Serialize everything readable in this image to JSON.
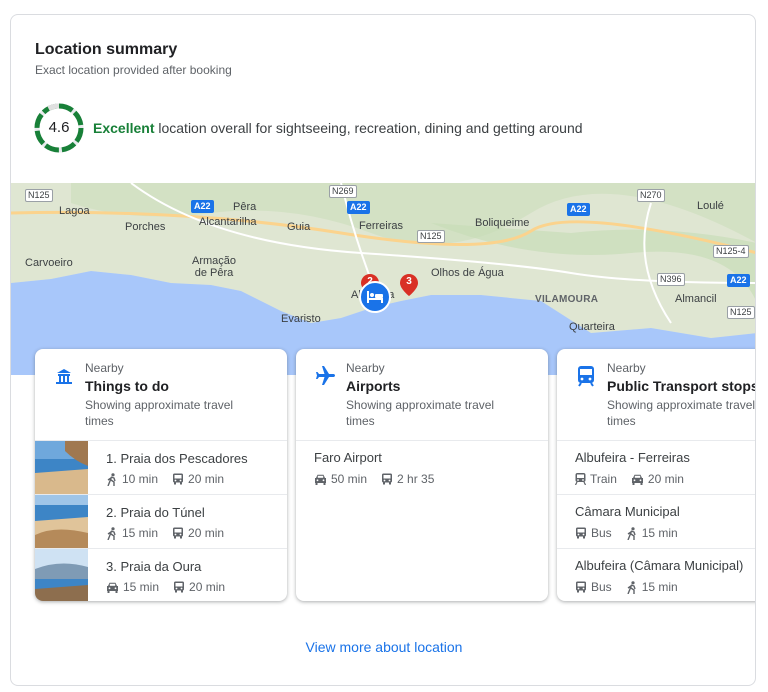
{
  "summary": {
    "title": "Location summary",
    "subtitle": "Exact location provided after booking",
    "score": "4.6",
    "score_fraction": 0.92,
    "rating_word": "Excellent",
    "rating_rest": " location overall for sightseeing, recreation, dining and getting around",
    "accent_color": "#188038"
  },
  "map": {
    "places": [
      "Lagoa",
      "Porches",
      "Pêra",
      "Alcantarilha",
      "Guia",
      "Ferreiras",
      "Boliqueime",
      "Loulé",
      "Carvoeiro",
      "Armação de Pêra",
      "Olhos de Água",
      "VILAMOURA",
      "Almancil",
      "Quarteira",
      "Evaristo",
      "Albufeira"
    ],
    "roads": [
      "N125",
      "N269",
      "A22",
      "A22",
      "A22",
      "N125",
      "N270",
      "N125-4",
      "N396",
      "A22",
      "N125"
    ],
    "pins": [
      "2",
      "3"
    ],
    "hotel_marker_icon": "bed-icon"
  },
  "cards": [
    {
      "kicker": "Nearby",
      "title": "Things to do",
      "desc": "Showing approximate travel times",
      "icon": "attraction-icon",
      "rows": [
        {
          "name": "1. Praia dos Pescadores",
          "t1_icon": "walk-icon",
          "t1": "10 min",
          "t2_icon": "bus-icon",
          "t2": "20 min"
        },
        {
          "name": "2. Praia do Túnel",
          "t1_icon": "walk-icon",
          "t1": "15 min",
          "t2_icon": "bus-icon",
          "t2": "20 min"
        },
        {
          "name": "3. Praia da Oura",
          "t1_icon": "car-icon",
          "t1": "15 min",
          "t2_icon": "bus-icon",
          "t2": "20 min"
        }
      ]
    },
    {
      "kicker": "Nearby",
      "title": "Airports",
      "desc": "Showing approximate travel times",
      "icon": "airplane-icon",
      "rows": [
        {
          "name": "Faro Airport",
          "t1_icon": "car-icon",
          "t1": "50 min",
          "t2_icon": "bus-icon",
          "t2": "2 hr 35"
        }
      ]
    },
    {
      "kicker": "Nearby",
      "title": "Public Transport stops",
      "desc": "Showing approximate travel times",
      "icon": "transit-icon",
      "rows": [
        {
          "name": "Albufeira - Ferreiras",
          "t1_icon": "train-icon",
          "t1": "Train",
          "t2_icon": "car-icon",
          "t2": "20 min"
        },
        {
          "name": "Câmara Municipal",
          "t1_icon": "bus-icon",
          "t1": "Bus",
          "t2_icon": "walk-icon",
          "t2": "15 min"
        },
        {
          "name": "Albufeira (Câmara Municipal)",
          "t1_icon": "bus-icon",
          "t1": "Bus",
          "t2_icon": "walk-icon",
          "t2": "15 min"
        }
      ]
    }
  ],
  "footer": {
    "link": "View more about location",
    "link_color": "#1a73e8"
  }
}
